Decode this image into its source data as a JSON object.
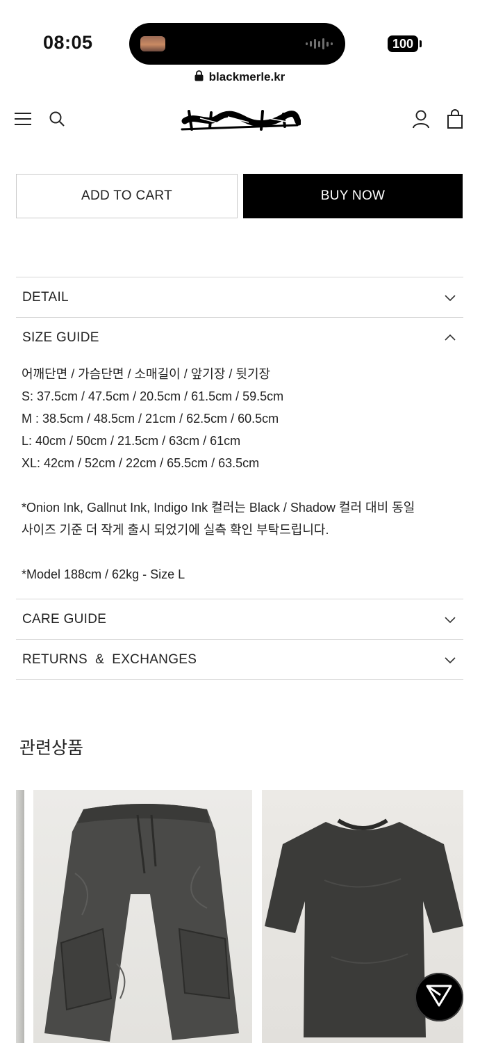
{
  "status_bar": {
    "time": "08:05",
    "battery": "100"
  },
  "browser": {
    "url": "blackmerle.kr"
  },
  "header": {
    "logo_text": "blackmerle",
    "icons": [
      "menu-icon",
      "search-icon",
      "account-icon",
      "bag-icon"
    ]
  },
  "actions": {
    "add_to_cart": "ADD TO CART",
    "buy_now": "BUY NOW"
  },
  "accordion": {
    "detail": "DETAIL",
    "size_guide": "SIZE GUIDE",
    "care_guide": "CARE GUIDE",
    "returns": "RETURNS  &  EXCHANGES"
  },
  "size_guide": {
    "header": "어깨단면 / 가슴단면 / 소매길이 / 앞기장 / 뒷기장",
    "rows": [
      "S: 37.5cm / 47.5cm / 20.5cm / 61.5cm / 59.5cm",
      "M : 38.5cm / 48.5cm / 21cm / 62.5cm / 60.5cm",
      "L: 40cm / 50cm / 21.5cm / 63cm / 61cm",
      "XL: 42cm / 52cm / 22cm / 65.5cm / 63.5cm"
    ],
    "note_line1": "*Onion Ink, Gallnut Ink, Indigo Ink 컬러는 Black / Shadow 컬러 대비 동일",
    "note_line2": "사이즈 기준 더 작게 출시 되었기에 실측 확인 부탁드립니다.",
    "model": "*Model 188cm / 62kg - Size L"
  },
  "related": {
    "title": "관련상품",
    "products": [
      {
        "image": "dark washed shorts"
      },
      {
        "image": "dark washed t-shirt"
      }
    ]
  },
  "colors": {
    "primary": "#000000",
    "divider": "#d6d6d6",
    "text": "#222222"
  }
}
